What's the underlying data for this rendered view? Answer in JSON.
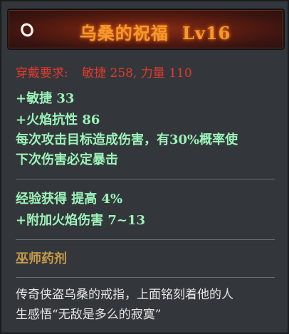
{
  "item": {
    "icon": "ring-icon",
    "title": "乌桑的祝福",
    "level": "Lv16"
  },
  "requirement": {
    "label": "穿戴要求:",
    "text": "敏捷 258, 力量 110"
  },
  "stats": [
    "+敏捷 33",
    "+火焰抗性 86",
    "每次攻击目标造成伤害，有30%概率使",
    "下次伤害必定暴击"
  ],
  "bonus": [
    "经验获得  提高  4%",
    "+附加火焰伤害  7~13"
  ],
  "set_name": "巫师药剂",
  "description": [
    "传奇侠盗乌桑的戒指，上面铭刻着他的人",
    "生感悟“无敌是多么的寂寞”"
  ],
  "colors": {
    "title": "#f39a2e",
    "requirement": "#e23a2c",
    "stat": "#9cf2b8",
    "set_name": "#c59a4a",
    "description": "#e6e6e6"
  }
}
